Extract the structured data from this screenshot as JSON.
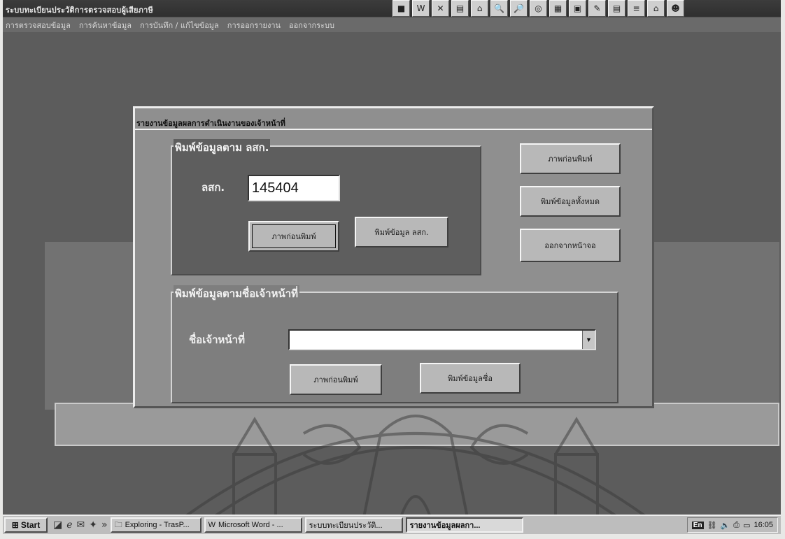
{
  "app": {
    "title": "ระบบทะเบียนประวัติการตรวจสอบผู้เสียภาษี"
  },
  "toolbar": {
    "icons": [
      "W",
      "✕",
      "▤",
      "⌂",
      "🔍",
      "🔎",
      "◎",
      "▦",
      "▣",
      "✎",
      "▤",
      "≡",
      "⌂",
      "☻"
    ]
  },
  "menu": [
    "การตรวจสอบข้อมูล",
    "การค้นหาข้อมูล",
    "การบันทึก / แก้ไขข้อมูล",
    "การออกรายงาน",
    "ออกจากระบบ"
  ],
  "dialog": {
    "title": "รายงานข้อมูลผลการดำเนินงานของเจ้าหน้าที่",
    "group_office": {
      "caption": "พิมพ์ข้อมูลตาม ลสก.",
      "field_label": "ลสก.",
      "field_value": "145404",
      "preview_button": "ภาพก่อนพิมพ์",
      "print_button": "พิมพ์ข้อมูล ลสก."
    },
    "side_buttons": {
      "preview": "ภาพก่อนพิมพ์",
      "print_all": "พิมพ์ข้อมูลทั้งหมด",
      "exit": "ออกจากหน้าจอ"
    },
    "group_name": {
      "caption": "พิมพ์ข้อมูลตามชื่อเจ้าหน้าที่",
      "field_label": "ชื่อเจ้าหน้าที่",
      "field_value": "",
      "preview_button": "ภาพก่อนพิมพ์",
      "print_button": "พิมพ์ข้อมูลชื่อ"
    }
  },
  "taskbar": {
    "start_label": "Start",
    "tasks": [
      "Exploring - TrasP...",
      "Microsoft Word - ...",
      "ระบบทะเบียนประวัติ...",
      "รายงานข้อมูลผลกา..."
    ],
    "active_task_index": 3,
    "language": "En",
    "clock": "16:05"
  }
}
